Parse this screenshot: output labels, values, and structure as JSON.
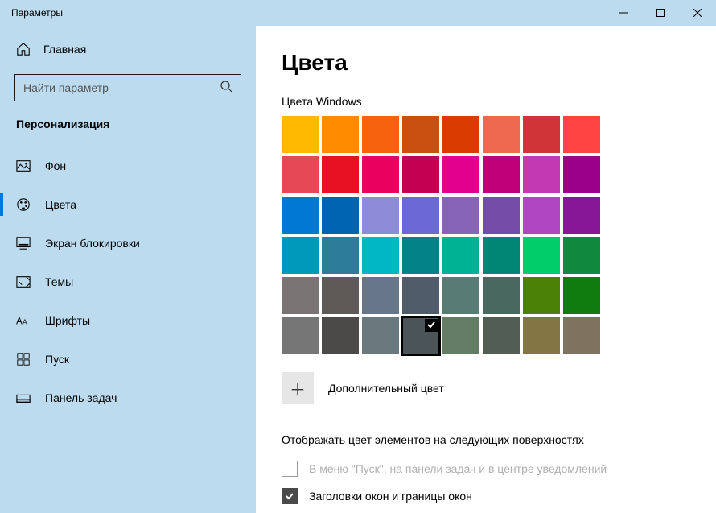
{
  "window": {
    "title": "Параметры"
  },
  "sidebar": {
    "home": "Главная",
    "search_placeholder": "Найти параметр",
    "category": "Персонализация",
    "items": [
      {
        "label": "Фон",
        "active": false
      },
      {
        "label": "Цвета",
        "active": true
      },
      {
        "label": "Экран блокировки",
        "active": false
      },
      {
        "label": "Темы",
        "active": false
      },
      {
        "label": "Шрифты",
        "active": false
      },
      {
        "label": "Пуск",
        "active": false
      },
      {
        "label": "Панель задач",
        "active": false
      }
    ]
  },
  "main": {
    "heading": "Цвета",
    "palette_label": "Цвета Windows",
    "colors": [
      "#ffb900",
      "#ff8c00",
      "#f7630c",
      "#ca5010",
      "#da3b01",
      "#ef6950",
      "#d13438",
      "#ff4343",
      "#e74856",
      "#e81123",
      "#ea005e",
      "#c30052",
      "#e3008c",
      "#bf0077",
      "#c239b3",
      "#9a0089",
      "#0078d4",
      "#0063b1",
      "#8e8cd8",
      "#6b69d6",
      "#8764b8",
      "#744da9",
      "#b146c2",
      "#881798",
      "#0099bc",
      "#2d7d9a",
      "#00b7c3",
      "#038387",
      "#00b294",
      "#018574",
      "#00cc6a",
      "#10893e",
      "#7a7574",
      "#5d5a58",
      "#68768a",
      "#515c6b",
      "#567c73",
      "#486860",
      "#498205",
      "#107c10",
      "#767676",
      "#4c4a48",
      "#69797e",
      "#4a5459",
      "#647c64",
      "#525e54",
      "#847545",
      "#7e735f"
    ],
    "selected_index": 43,
    "custom_color": "Дополнительный цвет",
    "surfaces_heading": "Отображать цвет элементов на следующих поверхностях",
    "option1": "В меню \"Пуск\", на панели задач и в центре уведомлений",
    "option1_checked": false,
    "option1_enabled": false,
    "option2": "Заголовки окон и границы окон",
    "option2_checked": true
  }
}
